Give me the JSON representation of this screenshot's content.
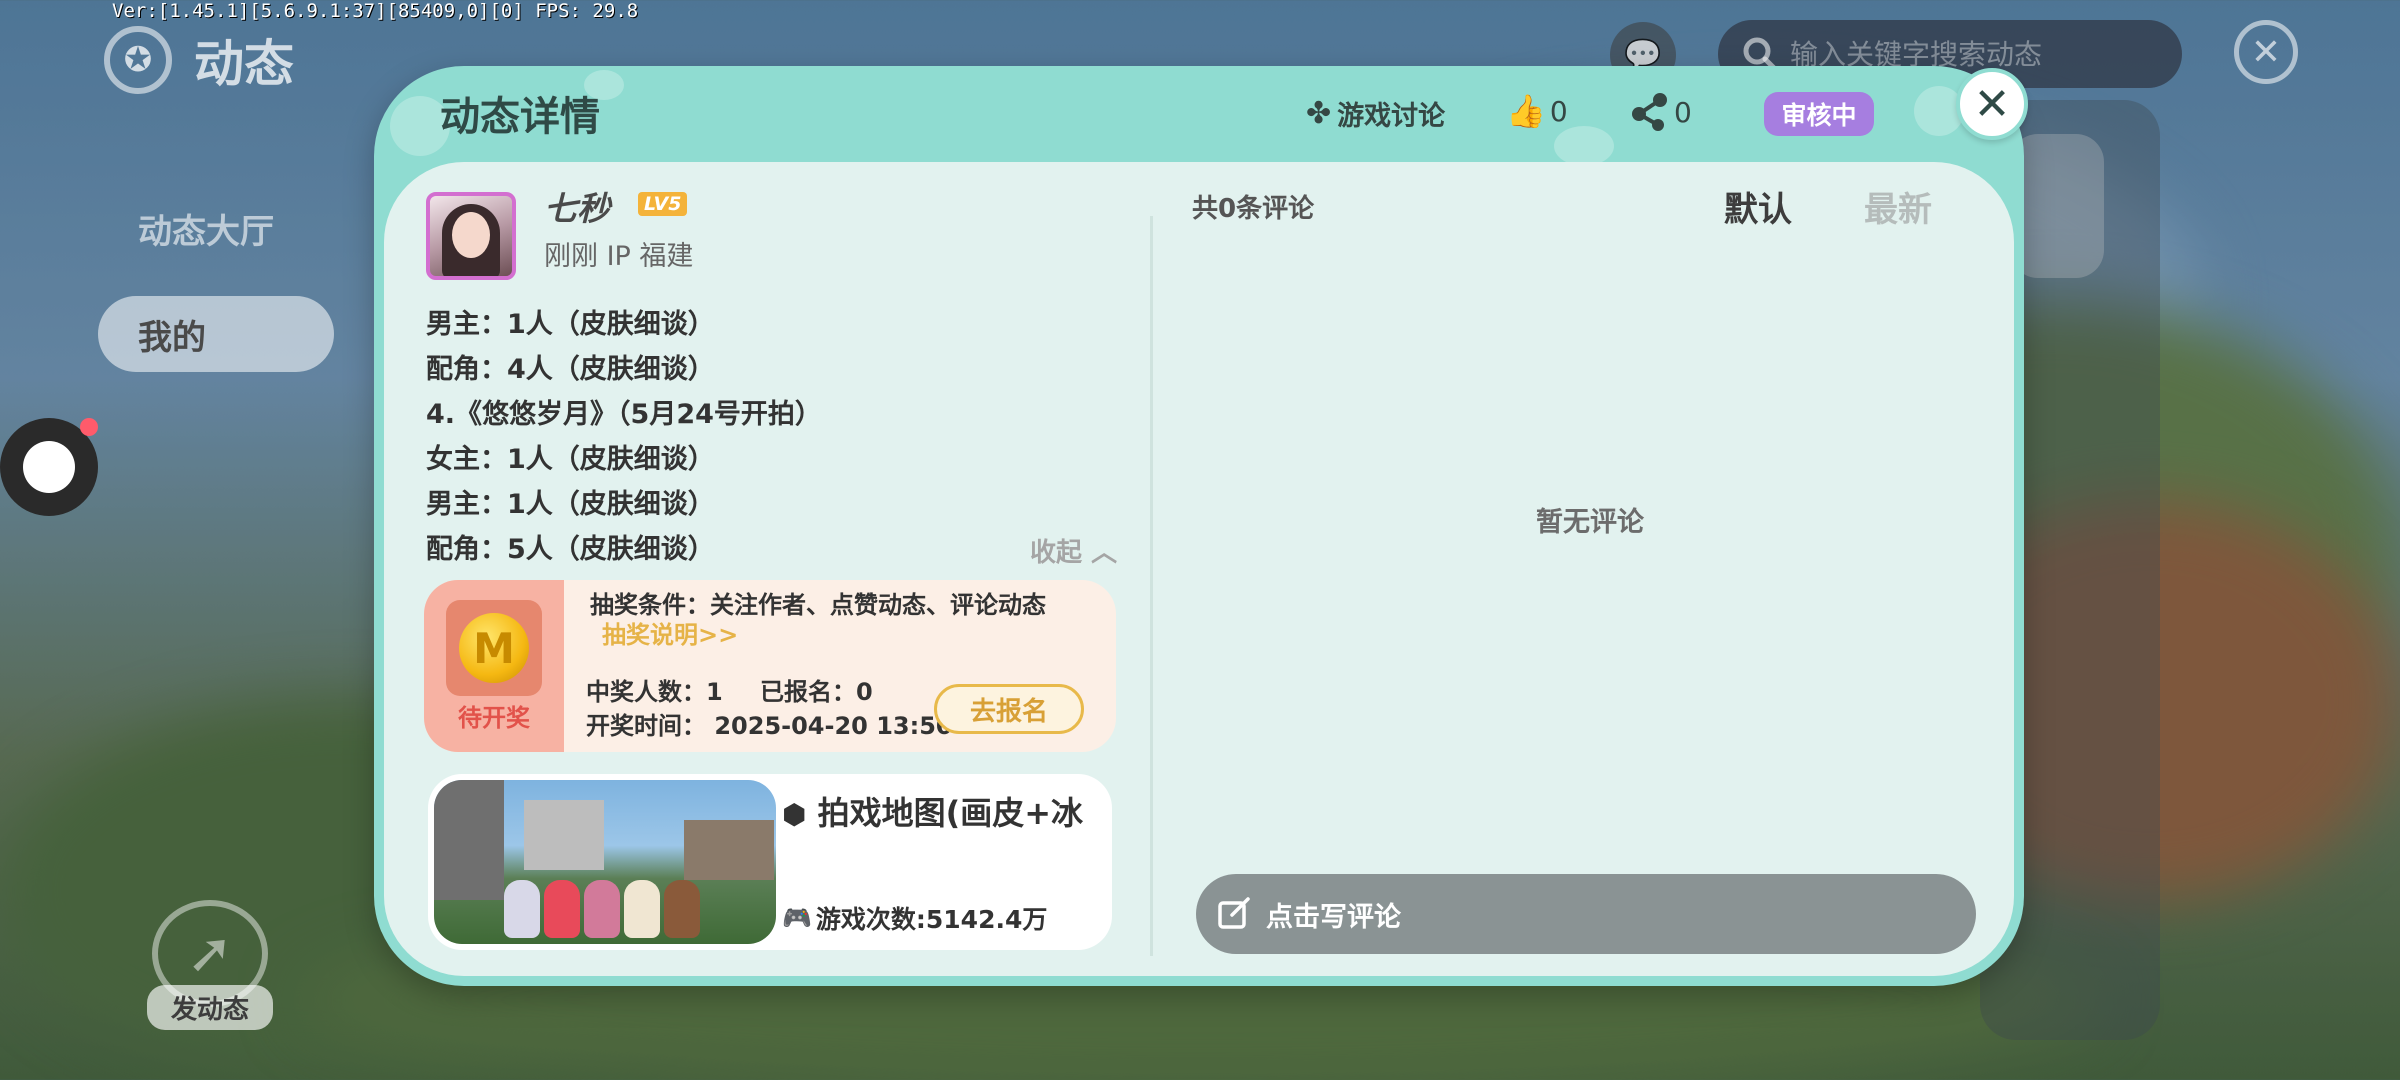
{
  "debug": {
    "text": "Ver:[1.45.1][5.6.9.1:37][85409,0][0] FPS: 29.8"
  },
  "page": {
    "title": "动态"
  },
  "side_menu": {
    "items": [
      {
        "label": "动态大厅"
      },
      {
        "label": "我的"
      }
    ]
  },
  "top_bar": {
    "search_placeholder": "输入关键字搜索动态"
  },
  "post_button": {
    "label": "发动态"
  },
  "modal": {
    "title": "动态详情",
    "topic": "游戏讨论",
    "likes": "0",
    "shares": "0",
    "status": "审核中"
  },
  "post": {
    "username": "七秒",
    "level": "LV5",
    "meta": "刚刚 IP 福建",
    "lines": [
      "男主：1人（皮肤细谈）",
      "配角：4人（皮肤细谈）",
      "4.《悠悠岁月》（5月24号开拍）",
      "女主：1人（皮肤细谈）",
      "男主：1人（皮肤细谈）",
      "配角：5人（皮肤细谈）"
    ],
    "collapse_label": "收起"
  },
  "lottery": {
    "status": "待开奖",
    "condition": "抽奖条件：关注作者、点赞动态、评论动态",
    "explain_link": "抽奖说明>>",
    "winners": "中奖人数：1",
    "signed": "已报名：0",
    "time": "开奖时间： 2025-04-20 13:50",
    "signup_label": "去报名"
  },
  "map_card": {
    "title": "拍戏地图(画皮+冰",
    "plays": "游戏次数:5142.4万"
  },
  "comments": {
    "count_label": "共0条评论",
    "sort_default": "默认",
    "sort_latest": "最新",
    "empty_text": "暂无评论",
    "write_label": "点击写评论"
  }
}
